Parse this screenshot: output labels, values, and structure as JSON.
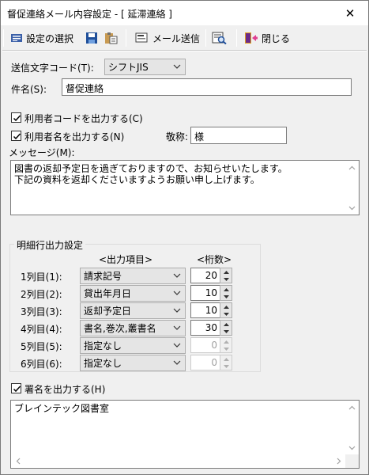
{
  "window": {
    "title": "督促連絡メール内容設定 - [ 延滞連絡 ]",
    "close_glyph": "✕"
  },
  "toolbar": {
    "select_settings_label": "設定の選択",
    "send_mail_label": "メール送信",
    "close_label": "閉じる",
    "icons": [
      "settings-select-icon",
      "save-icon",
      "paste-icon",
      "send-mail-icon",
      "preview-icon",
      "close-door-icon"
    ]
  },
  "form": {
    "encoding_label": "送信文字コード(T):",
    "encoding_value": "シフトJIS",
    "subject_label": "件名(S):",
    "subject_value": "督促連絡",
    "output_user_code_label": "利用者コードを出力する(C)",
    "output_user_code_checked": true,
    "output_user_name_label": "利用者名を出力する(N)",
    "output_user_name_checked": true,
    "honorific_label": "敬称:",
    "honorific_value": "様",
    "message_label": "メッセージ(M):",
    "message_text": "図書の返却予定日を過ぎておりますので、お知らせいたします。\n下記の資料を返却くださいますようお願い申し上げます。"
  },
  "details": {
    "group_title": "明細行出力設定",
    "col_item_header": "<出力項目>",
    "col_digits_header": "<桁数>",
    "rows": [
      {
        "label": "1列目(1):",
        "item": "請求記号",
        "digits": "20",
        "enabled": true
      },
      {
        "label": "2列目(2):",
        "item": "貸出年月日",
        "digits": "10",
        "enabled": true
      },
      {
        "label": "3列目(3):",
        "item": "返却予定日",
        "digits": "10",
        "enabled": true
      },
      {
        "label": "4列目(4):",
        "item": "書名,巻次,叢書名",
        "digits": "30",
        "enabled": true
      },
      {
        "label": "5列目(5):",
        "item": "指定なし",
        "digits": "0",
        "enabled": false
      },
      {
        "label": "6列目(6):",
        "item": "指定なし",
        "digits": "0",
        "enabled": false
      }
    ]
  },
  "signature": {
    "output_signature_label": "署名を出力する(H)",
    "output_signature_checked": true,
    "signature_text": "ブレインテック図書室"
  },
  "colors": {
    "window_bg": "#f0f0f0",
    "titlebar_bg": "#ffffff",
    "border": "#7a7a7a",
    "disabled_text": "#a0a0a0"
  }
}
